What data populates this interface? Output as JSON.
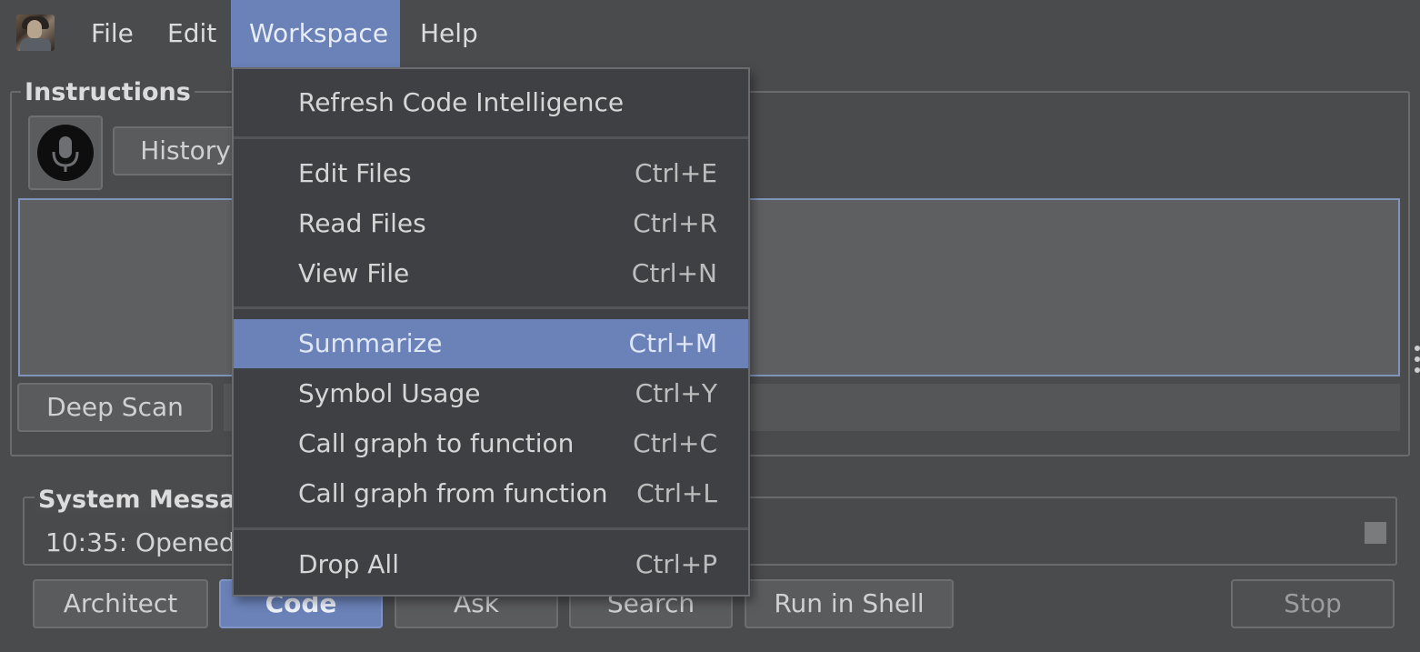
{
  "menubar": {
    "items": [
      {
        "label": "File"
      },
      {
        "label": "Edit"
      },
      {
        "label": "Workspace",
        "active": true
      },
      {
        "label": "Help"
      }
    ]
  },
  "instructions": {
    "title": "Instructions",
    "history_label": "History",
    "deep_scan_label": "Deep Scan"
  },
  "system_messages": {
    "title": "System Messag",
    "line": "10:35: Opened r"
  },
  "bottom_buttons": {
    "architect": "Architect",
    "code": "Code",
    "ask": "Ask",
    "search": "Search",
    "run_in_shell": "Run in Shell",
    "stop": "Stop"
  },
  "workspace_menu": {
    "items": [
      {
        "label": "Refresh Code Intelligence",
        "shortcut": ""
      },
      {
        "label": "Edit Files",
        "shortcut": "Ctrl+E"
      },
      {
        "label": "Read Files",
        "shortcut": "Ctrl+R"
      },
      {
        "label": "View File",
        "shortcut": "Ctrl+N"
      },
      {
        "label": "Summarize",
        "shortcut": "Ctrl+M",
        "highlighted": true
      },
      {
        "label": "Symbol Usage",
        "shortcut": "Ctrl+Y"
      },
      {
        "label": "Call graph to function",
        "shortcut": "Ctrl+C"
      },
      {
        "label": "Call graph from function",
        "shortcut": "Ctrl+L"
      },
      {
        "label": "Drop All",
        "shortcut": "Ctrl+P"
      }
    ]
  },
  "colors": {
    "accent": "#6a82b8",
    "background": "#4a4b4d",
    "menu_background": "#3f4044"
  }
}
